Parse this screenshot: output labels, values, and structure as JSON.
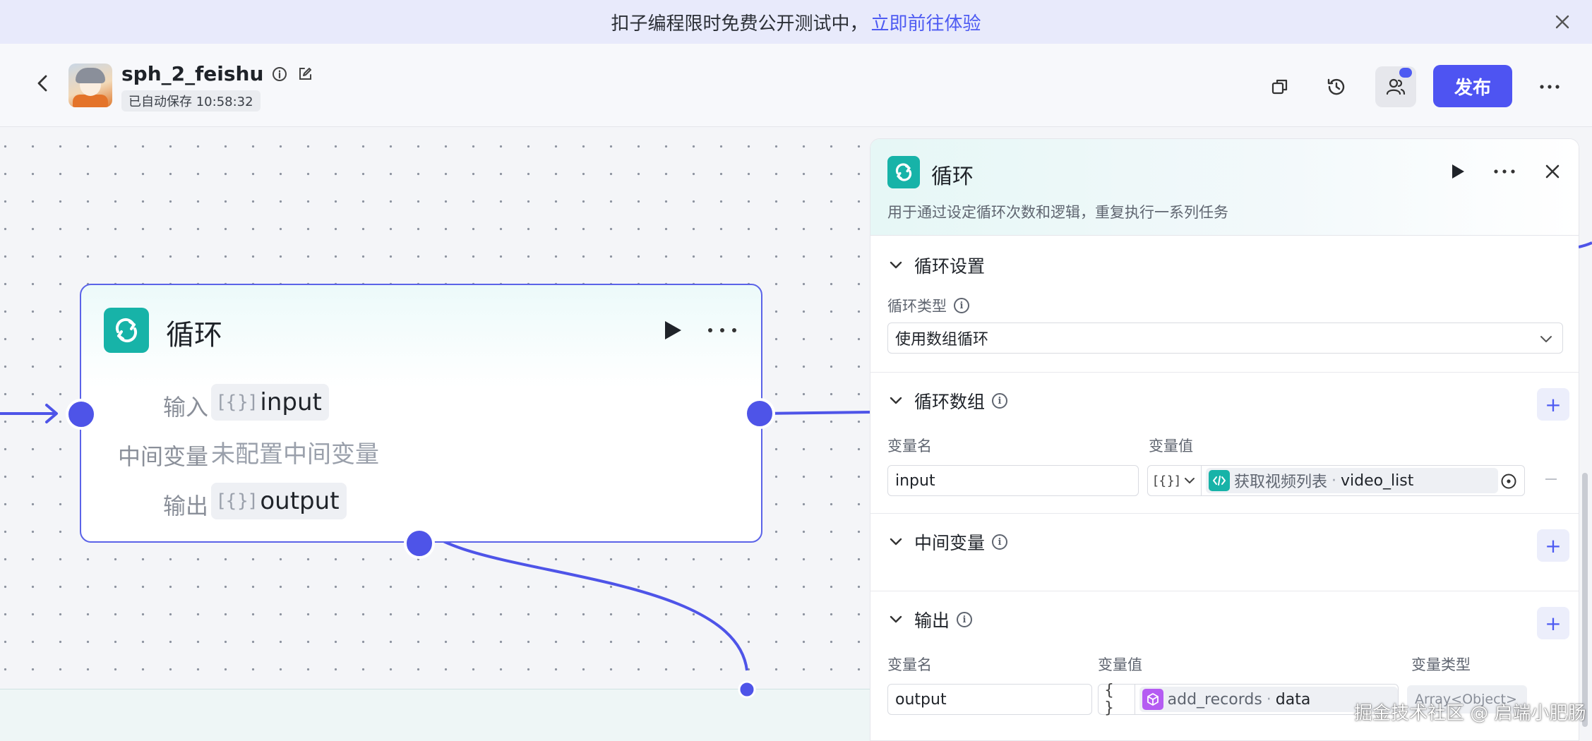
{
  "banner": {
    "text": "扣子编程限时免费公开测试中，",
    "link": "立即前往体验"
  },
  "header": {
    "project_name": "sph_2_feishu",
    "autosave": "已自动保存 10:58:32",
    "publish_label": "发布"
  },
  "node": {
    "title": "循环",
    "rows": [
      {
        "label": "输入",
        "value": "input"
      },
      {
        "label": "中间变量",
        "value": "未配置中间变量"
      },
      {
        "label": "输出",
        "value": "output"
      }
    ],
    "brace": "[{}]"
  },
  "panel": {
    "title": "循环",
    "description": "用于通过设定循环次数和逻辑，重复执行一系列任务",
    "loop_settings": {
      "title": "循环设置",
      "type_label": "循环类型",
      "type_value": "使用数组循环"
    },
    "loop_array": {
      "title": "循环数组",
      "name_header": "变量名",
      "value_header": "变量值",
      "name": "input",
      "type_tag": "[{}]",
      "ref_source": "获取视频列表",
      "ref_field": "video_list"
    },
    "intermediate": {
      "title": "中间变量"
    },
    "output": {
      "title": "输出",
      "name_header": "变量名",
      "value_header": "变量值",
      "type_header": "变量类型",
      "name": "output",
      "type_tag": "{ }",
      "ref_source": "add_records",
      "ref_field": "data",
      "type_value": "Array<Object>"
    }
  },
  "watermark": "掘金技术社区 @ 启端小肥肠",
  "colors": {
    "accent": "#4e54f2",
    "loop_node": "#17b3a8",
    "code_node": "#17b3a8",
    "plugin_node": "#b55cf2"
  }
}
